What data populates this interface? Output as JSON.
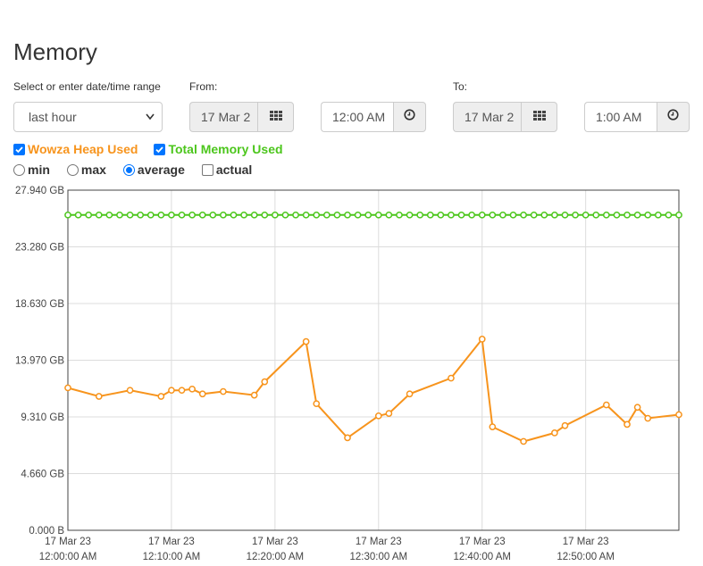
{
  "page": {
    "title": "Memory"
  },
  "range": {
    "label": "Select or enter date/time range",
    "selected": "last hour"
  },
  "from": {
    "label": "From:",
    "date": "17 Mar 2",
    "time": "12:00 AM"
  },
  "to": {
    "label": "To:",
    "date": "17 Mar 2",
    "time": "1:00 AM"
  },
  "icons": {
    "calendar": "calendar-grid-icon",
    "clock": "clock-icon"
  },
  "series_toggles": [
    {
      "label": "Wowza Heap Used",
      "checked": true,
      "color": "#f7941d"
    },
    {
      "label": "Total Memory Used",
      "checked": true,
      "color": "#4cc61c"
    }
  ],
  "aggregations": [
    {
      "label": "min",
      "selected": false,
      "kind": "radio"
    },
    {
      "label": "max",
      "selected": false,
      "kind": "radio"
    },
    {
      "label": "average",
      "selected": true,
      "kind": "radio"
    },
    {
      "label": "actual",
      "selected": false,
      "kind": "checkbox"
    }
  ],
  "chart_data": {
    "type": "line",
    "title": "",
    "xlabel": "",
    "ylabel": "",
    "grid": true,
    "x_unit": "minutes after 17 Mar 23 12:00:00 AM",
    "xlim": [
      0,
      59
    ],
    "ylim": [
      0,
      27.94
    ],
    "y_ticks": [
      "27.940 GB",
      "23.280 GB",
      "18.630 GB",
      "13.970 GB",
      "9.310 GB",
      "4.660 GB",
      "0.000 B"
    ],
    "x_ticks": [
      {
        "date": "17 Mar 23",
        "time": "12:00:00 AM",
        "x": 0
      },
      {
        "date": "17 Mar 23",
        "time": "12:10:00 AM",
        "x": 10
      },
      {
        "date": "17 Mar 23",
        "time": "12:20:00 AM",
        "x": 20
      },
      {
        "date": "17 Mar 23",
        "time": "12:30:00 AM",
        "x": 30
      },
      {
        "date": "17 Mar 23",
        "time": "12:40:00 AM",
        "x": 40
      },
      {
        "date": "17 Mar 23",
        "time": "12:50:00 AM",
        "x": 50
      }
    ],
    "series": [
      {
        "name": "Wowza Heap Used",
        "color": "#f7941d",
        "points": [
          [
            0,
            11.7
          ],
          [
            3,
            11.0
          ],
          [
            6,
            11.5
          ],
          [
            9,
            11.0
          ],
          [
            10,
            11.5
          ],
          [
            11,
            11.5
          ],
          [
            12,
            11.6
          ],
          [
            13,
            11.2
          ],
          [
            15,
            11.4
          ],
          [
            18,
            11.1
          ],
          [
            19,
            12.2
          ],
          [
            23,
            15.5
          ],
          [
            24,
            10.4
          ],
          [
            27,
            7.6
          ],
          [
            30,
            9.4
          ],
          [
            31,
            9.6
          ],
          [
            33,
            11.2
          ],
          [
            37,
            12.5
          ],
          [
            40,
            15.7
          ],
          [
            41,
            8.5
          ],
          [
            44,
            7.3
          ],
          [
            47,
            8.0
          ],
          [
            48,
            8.6
          ],
          [
            52,
            10.3
          ],
          [
            54,
            8.7
          ],
          [
            55,
            10.1
          ],
          [
            56,
            9.2
          ],
          [
            59,
            9.5
          ]
        ]
      },
      {
        "name": "Total Memory Used",
        "color": "#4cc61c",
        "constant": 25.9,
        "x_start": 0,
        "x_end": 59,
        "step": 1
      }
    ]
  }
}
